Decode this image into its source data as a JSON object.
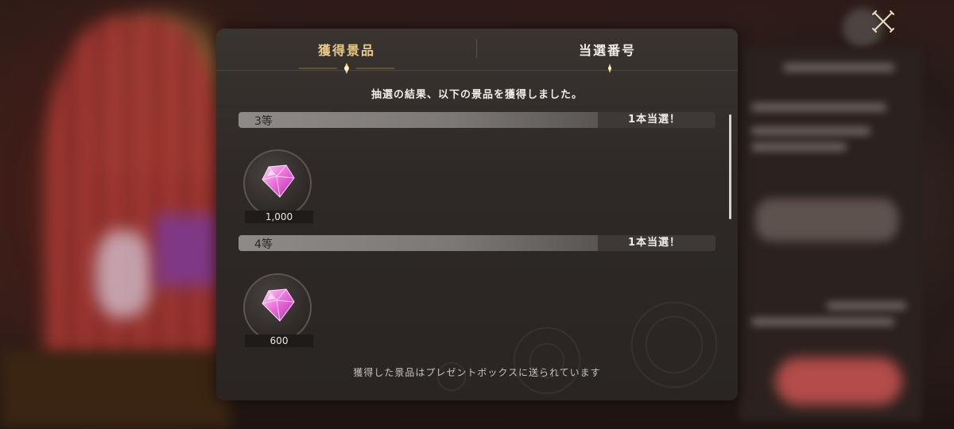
{
  "tabs": [
    {
      "label": "獲得景品",
      "active": true
    },
    {
      "label": "当選番号",
      "active": false
    }
  ],
  "subtitle": "抽選の結果、以下の景品を獲得しました。",
  "prizes": [
    {
      "rank": "3等",
      "count_label": "1本当選！",
      "item_icon": "gem-icon",
      "quantity": "1,000"
    },
    {
      "rank": "4等",
      "count_label": "1本当選！",
      "item_icon": "gem-icon",
      "quantity": "600"
    }
  ],
  "footer_note": "獲得した景品はプレゼントボックスに送られています",
  "close_icon": "close-icon",
  "colors": {
    "active_tab": "#e7c98a",
    "inactive_tab": "#f1ece6",
    "gem": "#e06ad8"
  }
}
